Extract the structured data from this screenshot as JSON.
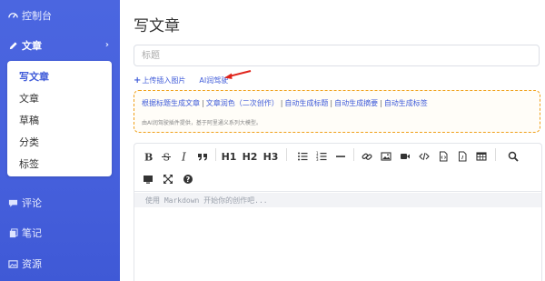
{
  "sidebar": {
    "items": [
      {
        "label": "控制台"
      },
      {
        "label": "文章"
      },
      {
        "label": "评论"
      },
      {
        "label": "笔记"
      },
      {
        "label": "资源"
      }
    ],
    "chevron": "›",
    "submenu": [
      "写文章",
      "文章",
      "草稿",
      "分类",
      "标签"
    ]
  },
  "main": {
    "title": "写文章",
    "title_placeholder": "标题",
    "upload_label": "上传插入图片",
    "ai_link": "AI润驾驶",
    "ai_actions": [
      "根据标题生成文章",
      "文章润色（二次创作）",
      "自动生成标题",
      "自动生成摘要",
      "自动生成标签"
    ],
    "ai_separator": "|",
    "ai_note": "由AI润驾驶插件提供，基于阿里通义系列大模型。",
    "toolbar_text": {
      "h1": "H1",
      "h2": "H2",
      "h3": "H3"
    },
    "editor_placeholder": "使用 Markdown 开始你的创作吧..."
  },
  "colors": {
    "sidebar": "#4660dc",
    "accent": "#3f5bd9",
    "ai_border": "#f0a019",
    "arrow": "#e0241b"
  }
}
